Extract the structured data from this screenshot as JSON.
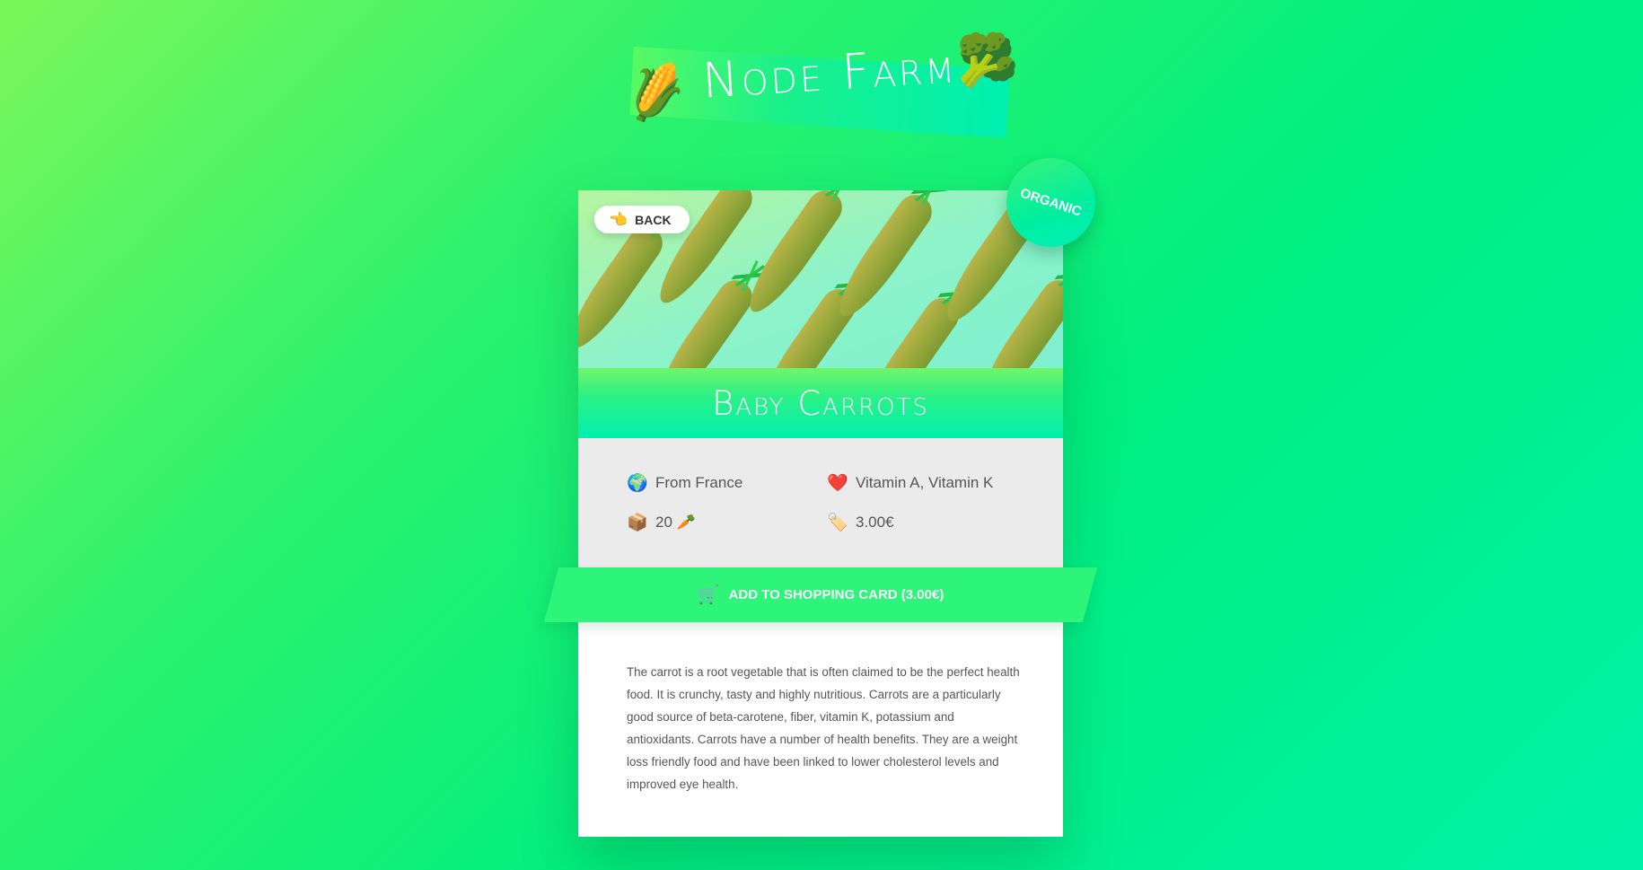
{
  "header": {
    "title": "Node Farm",
    "left_icon": "corn-icon",
    "right_icon": "broccoli-icon",
    "left_glyph": "🌽",
    "right_glyph": "🥦"
  },
  "product": {
    "back_label": "BACK",
    "back_glyph": "👈",
    "badge": "ORGANIC",
    "name": "Baby Carrots",
    "from_glyph": "🌍",
    "from": "From France",
    "nutrients_glyph": "❤️",
    "nutrients": "Vitamin A, Vitamin K",
    "quantity_glyph": "📦",
    "quantity": "20 🥕",
    "price_glyph": "🏷️",
    "price": "3.00€",
    "cart_glyph": "🛒",
    "add_label": "ADD TO SHOPPING CARD (3.00€)",
    "description": "The carrot is a root vegetable that is often claimed to be the perfect health food. It is crunchy, tasty and highly nutritious. Carrots are a particularly good source of beta-carotene, fiber, vitamin K, potassium and antioxidants. Carrots have a number of health benefits. They are a weight loss friendly food and have been linked to lower cholesterol levels and improved eye health."
  },
  "colors": {
    "accent": "#2df57a",
    "title_band": "#00f0b0",
    "panel": "#ebebeb"
  }
}
